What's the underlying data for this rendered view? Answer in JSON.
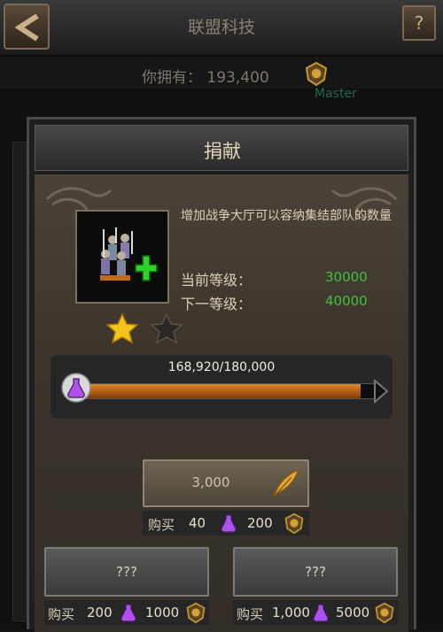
{
  "screen": {
    "title": "联盟科技",
    "owned_label": "你拥有：",
    "owned_value": "193,400",
    "background_text": "Master"
  },
  "dialog": {
    "title": "捐献",
    "description": "增加战争大厅可以容纳集结部队的数量",
    "current_level_label": "当前等级：",
    "current_level_value": "30000",
    "next_level_label": "下一等级：",
    "next_level_value": "40000",
    "stars": {
      "filled": 1,
      "total": 2
    },
    "progress": {
      "text": "168,920/180,000",
      "current": 168920,
      "max": 180000
    },
    "donate_main": {
      "label": "3,000",
      "buy_label": "购买",
      "buy_count": "40",
      "cost": "200"
    },
    "donate_left": {
      "label": "???",
      "buy_label": "购买",
      "buy_count": "200",
      "cost": "1000"
    },
    "donate_right": {
      "label": "???",
      "buy_label": "购买",
      "buy_count": "1,000",
      "cost": "5000"
    }
  },
  "colors": {
    "green_value": "#3ec23a",
    "progress_fill": "#c06818",
    "star_gold": "#f5c21a",
    "potion_purple": "#a050e0"
  },
  "icons": {
    "back": "back-arrow-icon",
    "help": "question-icon",
    "medal": "medal-icon",
    "feather": "feather-icon",
    "potion": "potion-icon",
    "star_filled": "star-filled-icon",
    "star_empty": "star-empty-icon"
  }
}
